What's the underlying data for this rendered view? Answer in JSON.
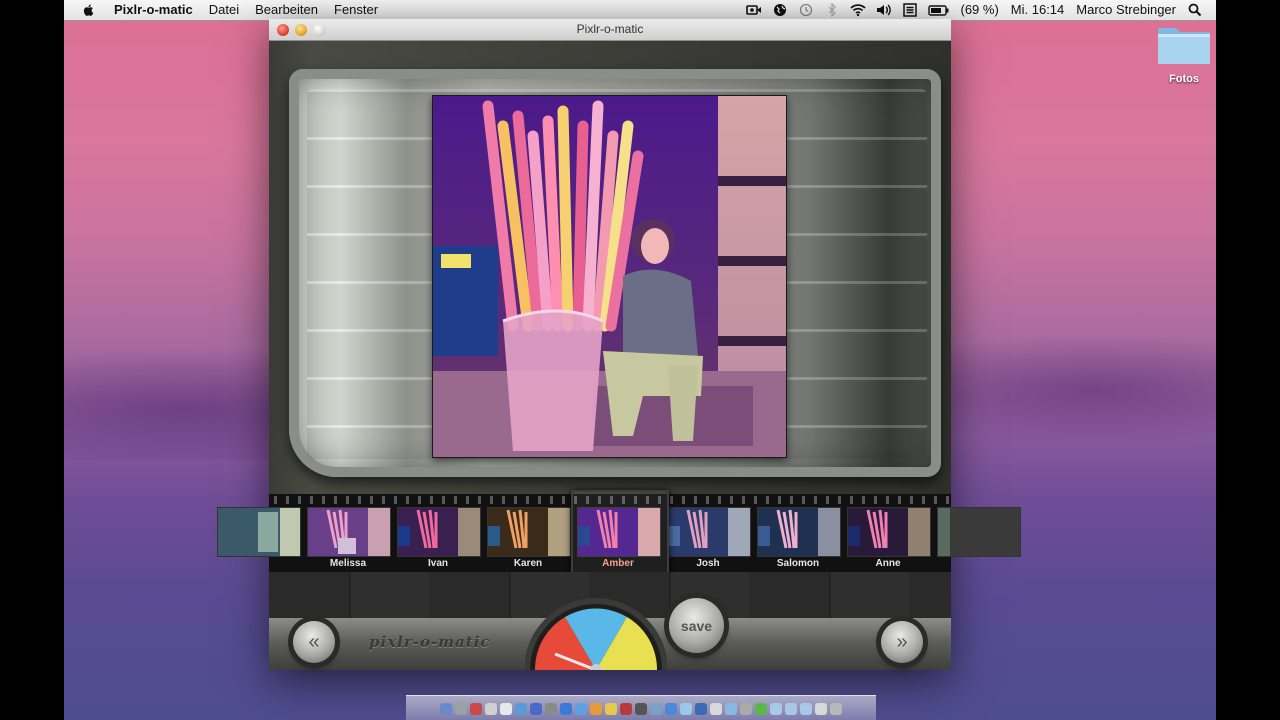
{
  "menubar": {
    "app_name": "Pixlr-o-matic",
    "menus": [
      "Datei",
      "Bearbeiten",
      "Fenster"
    ],
    "battery": "(69 %)",
    "clock": "Mi. 16:14",
    "user": "Marco Strebinger",
    "status_icons": [
      "facetime-camera-icon",
      "globe-icon",
      "time-machine-icon",
      "bluetooth-icon",
      "wifi-icon",
      "volume-icon",
      "keyboard-layout-icon",
      "battery-icon",
      "spotlight-icon"
    ]
  },
  "desktop": {
    "folder_label": "Fotos"
  },
  "window": {
    "title": "Pixlr-o-matic"
  },
  "filters": [
    {
      "name": "",
      "selected": false
    },
    {
      "name": "Melissa",
      "selected": false
    },
    {
      "name": "Ivan",
      "selected": false
    },
    {
      "name": "Karen",
      "selected": false
    },
    {
      "name": "Amber",
      "selected": true
    },
    {
      "name": "Josh",
      "selected": false
    },
    {
      "name": "Salomon",
      "selected": false
    },
    {
      "name": "Anne",
      "selected": false
    }
  ],
  "controls": {
    "save_label": "save",
    "prev_label": "«",
    "next_label": "»",
    "logo_text": "pixlr-o-matic"
  },
  "colors": {
    "selected_filter_label": "#f1a08a",
    "filter_label": "#e6e6e6"
  }
}
